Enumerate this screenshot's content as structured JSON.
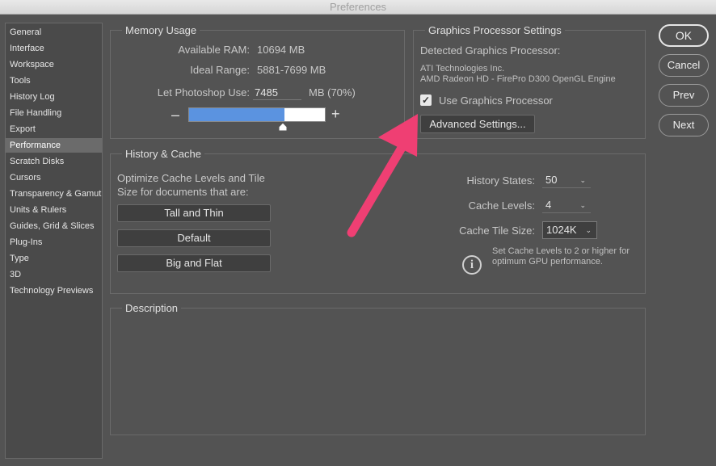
{
  "window": {
    "title": "Preferences"
  },
  "sidebar": {
    "items": [
      {
        "label": "General"
      },
      {
        "label": "Interface"
      },
      {
        "label": "Workspace"
      },
      {
        "label": "Tools"
      },
      {
        "label": "History Log"
      },
      {
        "label": "File Handling"
      },
      {
        "label": "Export"
      },
      {
        "label": "Performance",
        "selected": true
      },
      {
        "label": "Scratch Disks"
      },
      {
        "label": "Cursors"
      },
      {
        "label": "Transparency & Gamut"
      },
      {
        "label": "Units & Rulers"
      },
      {
        "label": "Guides, Grid & Slices"
      },
      {
        "label": "Plug-Ins"
      },
      {
        "label": "Type"
      },
      {
        "label": "3D"
      },
      {
        "label": "Technology Previews"
      }
    ]
  },
  "memory": {
    "title": "Memory Usage",
    "available_label": "Available RAM:",
    "available_value": "10694 MB",
    "ideal_label": "Ideal Range:",
    "ideal_value": "5881-7699 MB",
    "let_label": "Let Photoshop Use:",
    "let_value": "7485",
    "let_unit": "MB (70%)",
    "minus": "–",
    "plus": "+",
    "slider_percent": 70
  },
  "gpu": {
    "title": "Graphics Processor Settings",
    "detected_label": "Detected Graphics Processor:",
    "vendor": "ATI Technologies Inc.",
    "model": "AMD Radeon HD - FirePro D300 OpenGL Engine",
    "use_label": "Use Graphics Processor",
    "use_checked": "✓",
    "advanced_button": "Advanced Settings..."
  },
  "history": {
    "title": "History & Cache",
    "optimize_line1": "Optimize Cache Levels and Tile",
    "optimize_line2": "Size for documents that are:",
    "btn_tall": "Tall and Thin",
    "btn_default": "Default",
    "btn_big": "Big and Flat",
    "states_label": "History States:",
    "states_value": "50",
    "levels_label": "Cache Levels:",
    "levels_value": "4",
    "tile_label": "Cache Tile Size:",
    "tile_value": "1024K",
    "info_line1": "Set Cache Levels to 2 or higher for",
    "info_line2": "optimum GPU performance.",
    "info_icon": "i"
  },
  "description": {
    "title": "Description"
  },
  "buttons": {
    "ok": "OK",
    "cancel": "Cancel",
    "prev": "Prev",
    "next": "Next"
  },
  "colors": {
    "slider_fill": "#5b93e0",
    "annotation_arrow": "#ef3f73"
  }
}
